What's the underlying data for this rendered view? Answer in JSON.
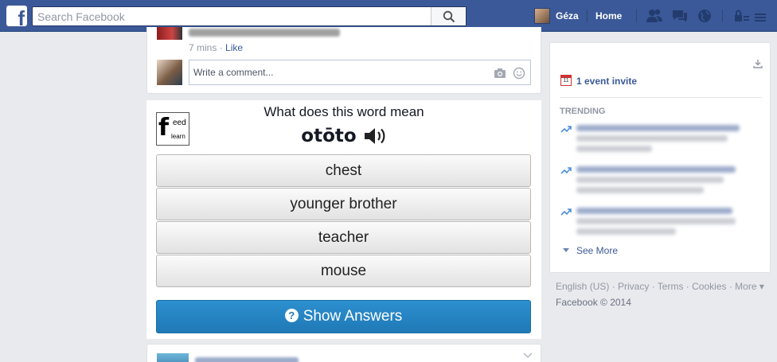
{
  "topbar": {
    "logo": "f",
    "search_placeholder": "Search Facebook",
    "user_name": "Géza",
    "home_label": "Home",
    "icons": [
      "friend-requests-icon",
      "messages-icon",
      "notifications-globe-icon",
      "privacy-shortcuts-icon"
    ]
  },
  "post_top": {
    "time": "7 mins",
    "sep": "·",
    "like": "Like",
    "comment_placeholder": "Write a comment..."
  },
  "quiz": {
    "question": "What does this word mean",
    "word": "otōto",
    "logo": {
      "f": "f",
      "eed": "eed",
      "learn": "learn"
    },
    "options": [
      "chest",
      "younger brother",
      "teacher",
      "mouse"
    ],
    "show_answers": "Show Answers"
  },
  "right": {
    "calendar_day": "11",
    "event_invite": "1 event invite",
    "trending_heading": "TRENDING",
    "see_more": "See More"
  },
  "footer": {
    "links": "English (US) · Privacy · Terms · Cookies · More ▾",
    "copyright": "Facebook © 2014"
  },
  "colors": {
    "brand": "#3b5998",
    "button_blue": "#1f79b6",
    "page_bg": "#e9eaed"
  }
}
